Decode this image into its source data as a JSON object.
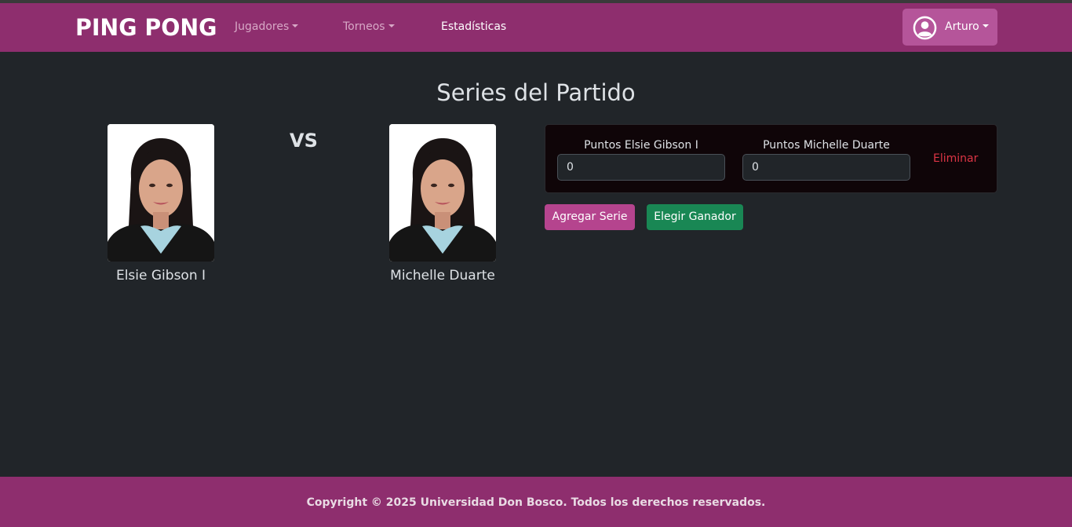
{
  "nav": {
    "brand": "PING PONG",
    "items": [
      {
        "label": "Jugadores",
        "dropdown": true
      },
      {
        "label": "Torneos",
        "dropdown": true
      },
      {
        "label": "Estadísticas",
        "dropdown": false
      }
    ],
    "user": {
      "name": "Arturo",
      "icon": "user-circle-icon"
    }
  },
  "main": {
    "title": "Series del Partido",
    "vs_label": "VS",
    "players": [
      {
        "name": "Elsie Gibson I"
      },
      {
        "name": "Michelle Duarte"
      }
    ],
    "series": [
      {
        "player1_label": "Puntos Elsie Gibson I",
        "player1_value": "0",
        "player2_label": "Puntos Michelle Duarte",
        "player2_value": "0",
        "delete_label": "Eliminar"
      }
    ],
    "add_series_label": "Agregar Serie",
    "choose_winner_label": "Elegir Ganador"
  },
  "footer": {
    "text": "Copyright © 2025 Universidad Don Bosco. Todos los derechos reservados."
  },
  "colors": {
    "navbar": "#8e2e6e",
    "background": "#212529",
    "add_button": "#b5448e",
    "winner_button": "#198754",
    "danger": "#dc3545"
  }
}
